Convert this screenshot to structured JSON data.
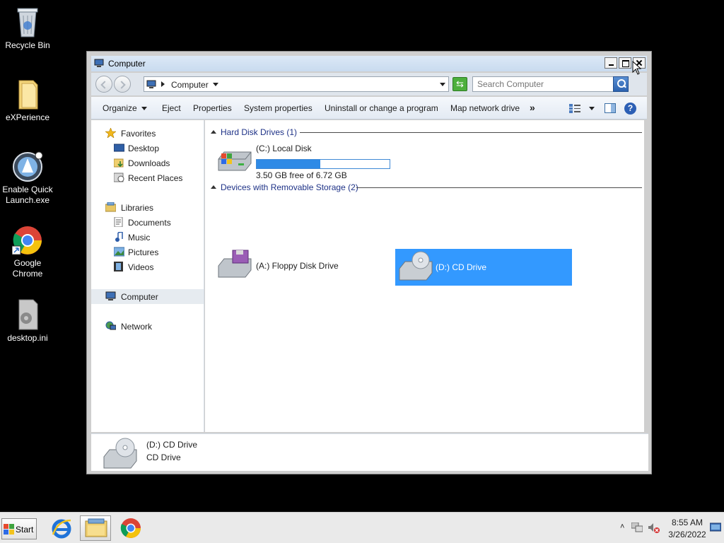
{
  "desktop": {
    "icons": [
      {
        "label": "Recycle Bin",
        "icon": "recycle-bin-icon"
      },
      {
        "label": "eXPerience",
        "icon": "folder-icon"
      },
      {
        "label": "Enable Quick Launch.exe",
        "icon": "quick-launch-icon"
      },
      {
        "label": "Google Chrome",
        "icon": "chrome-icon"
      },
      {
        "label": "desktop.ini",
        "icon": "settings-file-icon"
      }
    ]
  },
  "window": {
    "title": "Computer",
    "address": {
      "crumb": "Computer"
    },
    "search": {
      "placeholder": "Search Computer"
    },
    "toolbar": {
      "organize": "Organize",
      "eject": "Eject",
      "properties": "Properties",
      "system_properties": "System properties",
      "uninstall": "Uninstall or change a program",
      "map_network": "Map network drive",
      "more": "»"
    },
    "nav": {
      "favorites": "Favorites",
      "desktop": "Desktop",
      "downloads": "Downloads",
      "recent_places": "Recent Places",
      "libraries": "Libraries",
      "documents": "Documents",
      "music": "Music",
      "pictures": "Pictures",
      "videos": "Videos",
      "computer": "Computer",
      "network": "Network"
    },
    "content": {
      "hdd_group": "Hard Disk Drives (1)",
      "removable_group": "Devices with Removable Storage (2)",
      "local_disk": {
        "name": "(C:) Local Disk",
        "free_text": "3.50 GB free of 6.72 GB",
        "used_fraction": 0.48
      },
      "floppy": {
        "name": "(A:) Floppy Disk Drive"
      },
      "cd": {
        "name": "(D:) CD Drive"
      }
    },
    "details": {
      "name": "(D:) CD Drive",
      "type": "CD Drive"
    }
  },
  "taskbar": {
    "start": "Start",
    "clock": {
      "time": "8:55 AM",
      "date": "3/26/2022"
    }
  },
  "colors": {
    "selection": "#3399ff",
    "progress": "#2e8ae6",
    "group_text": "#1e3287"
  }
}
